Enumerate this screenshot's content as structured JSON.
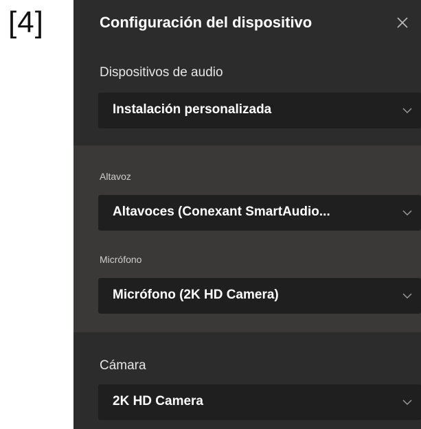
{
  "frame_label": "[4]",
  "dialog": {
    "title": "Configuración del dispositivo",
    "close_icon": "close-icon"
  },
  "audio_devices": {
    "label": "Dispositivos de audio",
    "selected": "Instalación personalizada"
  },
  "speaker": {
    "label": "Altavoz",
    "selected": "Altavoces (Conexant SmartAudio..."
  },
  "microphone": {
    "label": "Micrófono",
    "selected": "Micrófono (2K HD Camera)"
  },
  "camera": {
    "label": "Cámara",
    "selected": "2K HD Camera"
  },
  "colors": {
    "panel_bg": "#2d2c2c",
    "sub_region_bg": "#3a3938",
    "dropdown_bg": "#1f1f1f",
    "text_primary": "#ffffff"
  }
}
